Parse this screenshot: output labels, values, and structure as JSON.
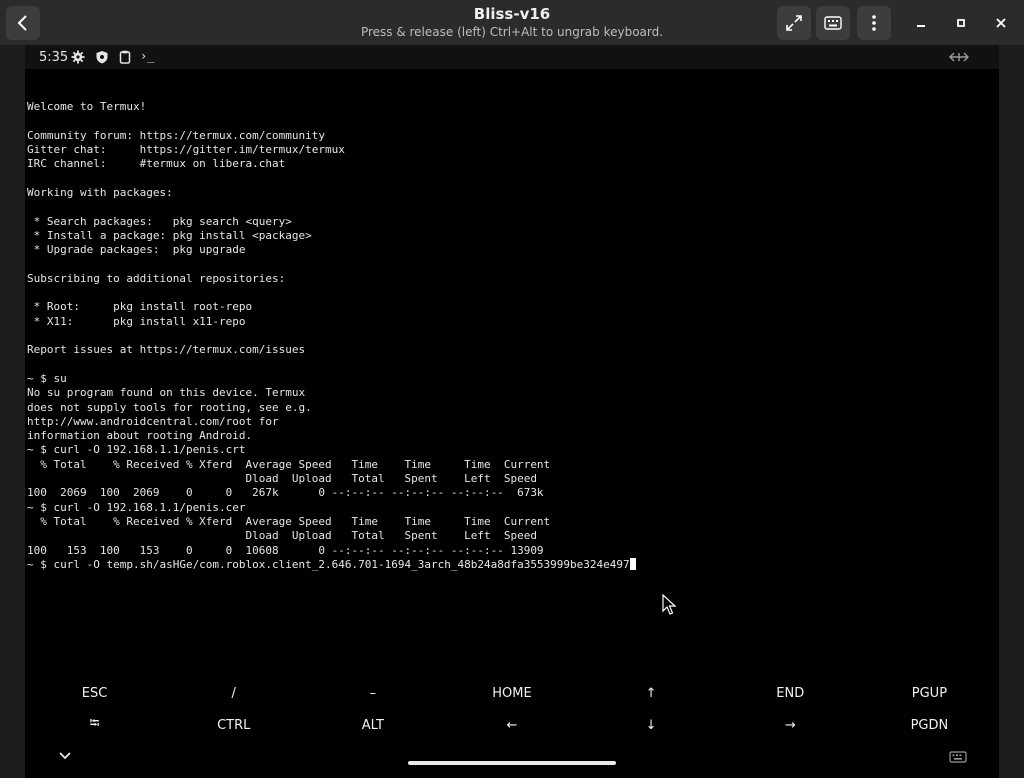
{
  "window": {
    "title": "Bliss-v16",
    "subtitle": "Press & release (left) Ctrl+Alt to ungrab keyboard."
  },
  "statusbar": {
    "time": "5:35",
    "prompt_glyph": "›_"
  },
  "terminal": {
    "lines": [
      "",
      "Welcome to Termux!",
      "",
      "Community forum: https://termux.com/community",
      "Gitter chat:     https://gitter.im/termux/termux",
      "IRC channel:     #termux on libera.chat",
      "",
      "Working with packages:",
      "",
      " * Search packages:   pkg search <query>",
      " * Install a package: pkg install <package>",
      " * Upgrade packages:  pkg upgrade",
      "",
      "Subscribing to additional repositories:",
      "",
      " * Root:     pkg install root-repo",
      " * X11:      pkg install x11-repo",
      "",
      "Report issues at https://termux.com/issues",
      "",
      "~ $ su",
      "No su program found on this device. Termux",
      "does not supply tools for rooting, see e.g.",
      "http://www.androidcentral.com/root for",
      "information about rooting Android.",
      "~ $ curl -O 192.168.1.1/penis.crt",
      "  % Total    % Received % Xferd  Average Speed   Time    Time     Time  Current",
      "                                 Dload  Upload   Total   Spent    Left  Speed",
      "100  2069  100  2069    0     0   267k      0 --:--:-- --:--:-- --:--:--  673k",
      "~ $ curl -O 192.168.1.1/penis.cer",
      "  % Total    % Received % Xferd  Average Speed   Time    Time     Time  Current",
      "                                 Dload  Upload   Total   Spent    Left  Speed",
      "100   153  100   153    0     0  10608      0 --:--:-- --:--:-- --:--:-- 13909"
    ],
    "current_command": "~ $ curl -O temp.sh/asHGe/com.roblox.client_2.646.701-1694_3arch_48b24a8dfa3553999be324e497"
  },
  "extra_keys": {
    "row1": [
      "ESC",
      "/",
      "–",
      "HOME",
      "↑",
      "END",
      "PGUP"
    ],
    "row2": [
      "⭾",
      "CTRL",
      "ALT",
      "←",
      "↓",
      "→",
      "PGDN"
    ]
  },
  "colors": {
    "terminal_bg": "#000000",
    "terminal_fg": "#e6e6e6",
    "header_bg": "#2b2b2b"
  }
}
